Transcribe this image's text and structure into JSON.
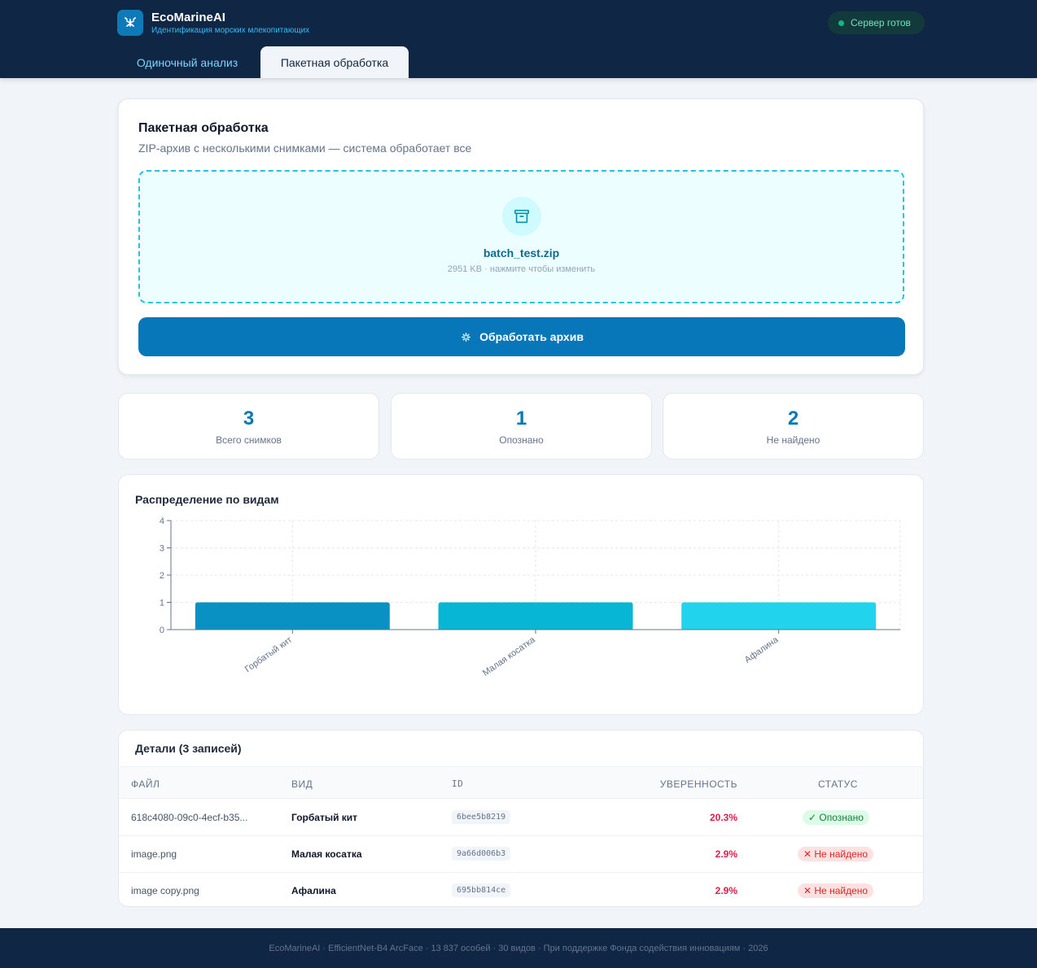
{
  "header": {
    "app_name": "EcoMarineAI",
    "app_subtitle": "Идентификация морских млекопитающих",
    "server_status": "Сервер готов",
    "tabs": [
      {
        "label": "Одиночный анализ",
        "active": false
      },
      {
        "label": "Пакетная обработка",
        "active": true
      }
    ]
  },
  "upload": {
    "title": "Пакетная обработка",
    "description": "ZIP-архив с несколькими снимками — система обработает все",
    "file_name": "batch_test.zip",
    "file_meta": "2951 KB · нажмите чтобы изменить",
    "button_label": "Обработать архив"
  },
  "stats": [
    {
      "value": "3",
      "label": "Всего снимков"
    },
    {
      "value": "1",
      "label": "Опознано"
    },
    {
      "value": "2",
      "label": "Не найдено"
    }
  ],
  "chart": {
    "title": "Распределение по видам"
  },
  "chart_data": {
    "type": "bar",
    "categories": [
      "Горбатый кит",
      "Малая косатка",
      "Афалина"
    ],
    "values": [
      1,
      1,
      1
    ],
    "colors": [
      "#0891c2",
      "#06b6d4",
      "#22d3ee"
    ],
    "yticks": [
      0,
      1,
      2,
      3,
      4
    ],
    "ylim": [
      0,
      4
    ],
    "grid": true
  },
  "details": {
    "title": "Детали (3 записей)",
    "columns": [
      "ФАЙЛ",
      "ВИД",
      "ID",
      "УВЕРЕННОСТЬ",
      "СТАТУС"
    ],
    "rows": [
      {
        "file": "618c4080-09c0-4ecf-b35...",
        "species": "Горбатый кит",
        "id": "6bee5b8219",
        "confidence": "20.3%",
        "status": "✓ Опознано",
        "ok": true
      },
      {
        "file": "image.png",
        "species": "Малая косатка",
        "id": "9a66d006b3",
        "confidence": "2.9%",
        "status": "✕ Не найдено",
        "ok": false
      },
      {
        "file": "image copy.png",
        "species": "Афалина",
        "id": "695bb814ce",
        "confidence": "2.9%",
        "status": "✕ Не найдено",
        "ok": false
      }
    ]
  },
  "footer": {
    "text": "EcoMarineAI · EfficientNet-B4 ArcFace · 13 837 особей · 30 видов · При поддержке Фонда содействия инновациям · 2026"
  }
}
